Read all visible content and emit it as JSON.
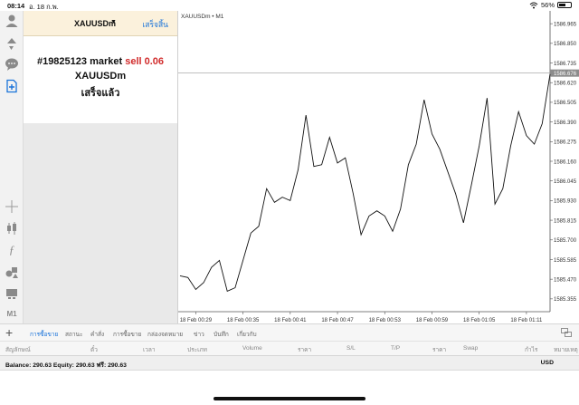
{
  "status_bar": {
    "time": "08:14",
    "date": "อ. 18 ก.พ.",
    "battery_text": "56%",
    "battery_level": 0.56
  },
  "order_panel": {
    "symbol": "XAUUSDm",
    "done_label": "เสร็จสิ้น",
    "line1_prefix": "#19825123 market ",
    "line1_type": "sell 0.06",
    "line2": "XAUUSDm",
    "line3": "เสร็จแล้ว"
  },
  "chart": {
    "title": "XAUUSDm • M1",
    "current_price_label": "1586.676"
  },
  "chart_data": {
    "type": "line",
    "title": "XAUUSDm • M1",
    "y_ticks": [
      1586.965,
      1586.85,
      1586.735,
      1586.62,
      1586.505,
      1586.39,
      1586.275,
      1586.16,
      1586.045,
      1585.93,
      1585.815,
      1585.7,
      1585.585,
      1585.47,
      1585.355
    ],
    "x_ticks": [
      "18 Feb 00:29",
      "18 Feb 00:35",
      "18 Feb 00:41",
      "18 Feb 00:47",
      "18 Feb 00:53",
      "18 Feb 00:59",
      "18 Feb 01:05",
      "18 Feb 01:11"
    ],
    "ylim": [
      1585.28,
      1587.04
    ],
    "current_price": 1586.676,
    "values": [
      1585.49,
      1585.48,
      1585.41,
      1585.45,
      1585.54,
      1585.58,
      1585.4,
      1585.42,
      1585.58,
      1585.74,
      1585.78,
      1586.0,
      1585.92,
      1585.95,
      1585.93,
      1586.11,
      1586.43,
      1586.13,
      1586.14,
      1586.3,
      1586.15,
      1586.18,
      1585.97,
      1585.73,
      1585.84,
      1585.87,
      1585.84,
      1585.75,
      1585.88,
      1586.14,
      1586.26,
      1586.52,
      1586.32,
      1586.23,
      1586.1,
      1585.97,
      1585.8,
      1586.02,
      1586.25,
      1586.53,
      1585.91,
      1586.0,
      1586.25,
      1586.45,
      1586.31,
      1586.26,
      1586.38,
      1586.67
    ]
  },
  "tabs": {
    "items": [
      "การซื้อขาย",
      "สถานะ",
      "คำสั่ง",
      "การซื้อขาย",
      "กล่องจดหมาย",
      "ข่าว",
      "บันทึก",
      "เกี่ยวกับ"
    ],
    "active_index": 0
  },
  "columns": [
    "สัญลักษณ์",
    "ตั๋ว",
    "เวลา",
    "ประเภท",
    "Volume",
    "ราคา",
    "S/L",
    "T/P",
    "ราคา",
    "Swap",
    "กำไร",
    "หมายเหตุ"
  ],
  "balance": {
    "text": "Balance: 290.63 Equity: 290.63 ฟรี: 290.63",
    "currency": "USD"
  },
  "toolbar": {
    "bottom_label": "M1"
  },
  "colors": {
    "accent": "#1a73d9",
    "sell": "#d12c2c",
    "order_header_bg": "#fbf1dc"
  }
}
